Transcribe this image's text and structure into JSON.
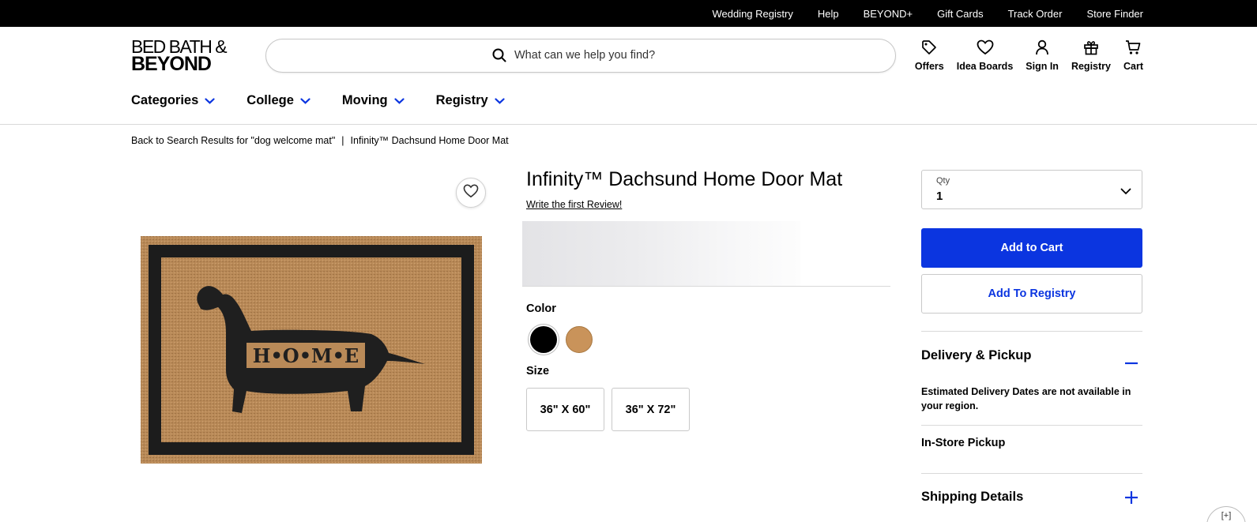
{
  "topbar": {
    "links": [
      "Wedding Registry",
      "Help",
      "BEYOND+",
      "Gift Cards",
      "Track Order",
      "Store Finder"
    ]
  },
  "header": {
    "logo_line1": "BED BATH &",
    "logo_line2": "BEYOND",
    "search_placeholder": "What can we help you find?",
    "icons": [
      {
        "label": "Offers",
        "icon": "tag-icon"
      },
      {
        "label": "Idea Boards",
        "icon": "heart-icon"
      },
      {
        "label": "Sign In",
        "icon": "user-icon"
      },
      {
        "label": "Registry",
        "icon": "gift-icon"
      },
      {
        "label": "Cart",
        "icon": "cart-icon"
      }
    ]
  },
  "nav": {
    "items": [
      "Categories",
      "College",
      "Moving",
      "Registry"
    ]
  },
  "breadcrumb": {
    "back": "Back to Search Results for \"dog welcome mat\"",
    "separator": "|",
    "current": "Infinity™ Dachsund Home Door Mat"
  },
  "product": {
    "title": "Infinity™ Dachsund Home Door Mat",
    "review_link": "Write the first Review!",
    "mat_text": "H•O•M•E",
    "color_label": "Color",
    "colors": [
      {
        "name": "black",
        "hex": "#000000"
      },
      {
        "name": "tan",
        "hex": "#c9935a"
      }
    ],
    "size_label": "Size",
    "sizes": [
      "36\" X 60\"",
      "36\" X 72\""
    ]
  },
  "purchase": {
    "qty_label": "Qty",
    "qty_value": "1",
    "add_to_cart": "Add to Cart",
    "add_to_registry": "Add To Registry",
    "accent_color": "#0b35e0"
  },
  "delivery": {
    "title": "Delivery & Pickup",
    "note": "Estimated Delivery Dates are not available in your region.",
    "instore": "In-Store Pickup"
  },
  "shipping": {
    "title": "Shipping Details"
  },
  "chat": {
    "label": "[+]"
  }
}
